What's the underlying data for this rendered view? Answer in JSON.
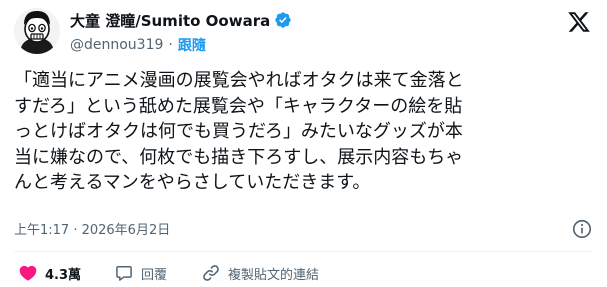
{
  "author": {
    "display_name": "大童 澄瞳/Sumito Oowara",
    "handle": "@dennou319",
    "separator": "·",
    "follow_label": "跟隨",
    "avatar_icon": "avatar-portrait-icon",
    "verified_icon": "verified-badge-icon"
  },
  "platform_icon": "x-logo-icon",
  "tweet": {
    "lines": [
      "「適当にアニメ漫画の展覧会やればオタクは来て金落と",
      "すだろ」という舐めた展覧会や「キャラクターの絵を貼",
      "っとけばオタクは何でも買うだろ」みたいなグッズが本",
      "当に嫌なので、何枚でも描き下ろすし、展示内容もちゃ",
      "んと考えるマンをやらさしていただきます。"
    ],
    "timestamp": "上午1:17 · 2026年6月2日"
  },
  "actions": {
    "like_count": "4.3萬",
    "reply_label": "回覆",
    "copy_link_label": "複製貼文的連結"
  },
  "colors": {
    "accent": "#1d9bf0",
    "like": "#f91880",
    "text_primary": "#0f1419",
    "text_secondary": "#536471"
  }
}
